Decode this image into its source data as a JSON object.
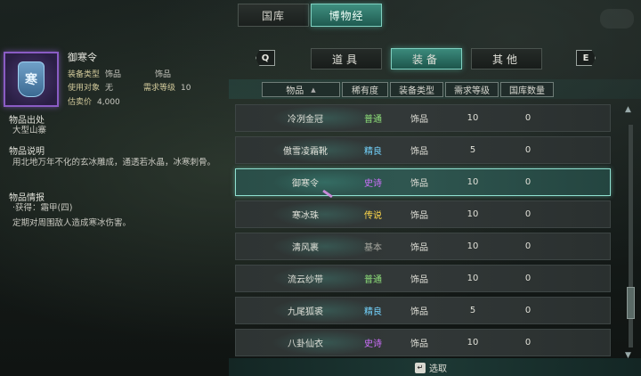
{
  "top_tabs": [
    {
      "label": "国库",
      "active": false
    },
    {
      "label": "博物经",
      "active": true
    }
  ],
  "item": {
    "name": "御寒令",
    "icon_glyph": "寒",
    "attrs": {
      "type_key": "装备类型",
      "type_val1": "饰品",
      "type_val2": "饰品",
      "target_key": "使用对象",
      "target_val": "无",
      "level_key": "需求等级",
      "level_val": "10",
      "price_key": "估卖价",
      "price_val": "4,000"
    },
    "source_title": "物品出处",
    "source_text": "大型山寨",
    "desc_title": "物品说明",
    "desc_text": "用北地万年不化的玄冰雕成，通透若水晶，冰寒刺骨。",
    "info_title": "物品情报",
    "info_line1": "·获得：霜甲(四)",
    "info_line2": "定期对周围敌人造成寒冰伤害。"
  },
  "categories": {
    "left_key": "Q",
    "right_key": "E",
    "tabs": [
      {
        "label": "道具",
        "active": false
      },
      {
        "label": "装备",
        "active": true
      },
      {
        "label": "其他",
        "active": false
      }
    ]
  },
  "table": {
    "headers": [
      "物品",
      "稀有度",
      "装备类型",
      "需求等级",
      "国库数量"
    ],
    "rows": [
      {
        "name": "冷冽金冠",
        "rarity": "普通",
        "rarity_class": "common",
        "type": "饰品",
        "level": "10",
        "qty": "0"
      },
      {
        "name": "傲雪凌霜靴",
        "rarity": "精良",
        "rarity_class": "fine",
        "type": "饰品",
        "level": "5",
        "qty": "0"
      },
      {
        "name": "御寒令",
        "rarity": "史诗",
        "rarity_class": "epic",
        "type": "饰品",
        "level": "10",
        "qty": "0",
        "selected": true
      },
      {
        "name": "寒冰珠",
        "rarity": "传说",
        "rarity_class": "legend",
        "type": "饰品",
        "level": "10",
        "qty": "0"
      },
      {
        "name": "清风裹",
        "rarity": "基本",
        "rarity_class": "basic",
        "type": "饰品",
        "level": "10",
        "qty": "0"
      },
      {
        "name": "流云纱带",
        "rarity": "普通",
        "rarity_class": "common",
        "type": "饰品",
        "level": "10",
        "qty": "0"
      },
      {
        "name": "九尾狐裘",
        "rarity": "精良",
        "rarity_class": "fine",
        "type": "饰品",
        "level": "5",
        "qty": "0"
      },
      {
        "name": "八卦仙衣",
        "rarity": "史诗",
        "rarity_class": "epic",
        "type": "饰品",
        "level": "10",
        "qty": "0"
      }
    ]
  },
  "bottom_hint": "选取",
  "colors": {
    "accent": "#3b8a7c",
    "common": "#8fe07a",
    "fine": "#74d4ff",
    "epic": "#d070ff",
    "legend": "#ffd84a",
    "basic": "#a8a8a0"
  }
}
